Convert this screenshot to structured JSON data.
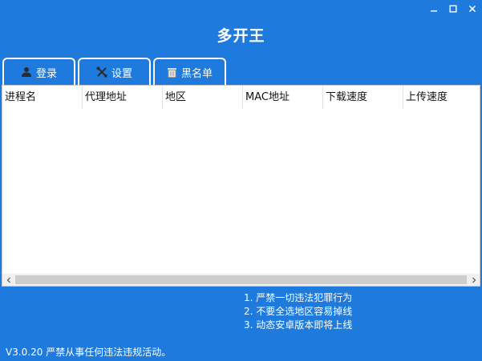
{
  "app": {
    "title": "多开王"
  },
  "tabs": [
    {
      "label": "登录",
      "icon": "user-icon"
    },
    {
      "label": "设置",
      "icon": "tools-icon"
    },
    {
      "label": "黑名单",
      "icon": "trash-icon"
    }
  ],
  "table": {
    "columns": [
      "进程名",
      "代理地址",
      "地区",
      "MAC地址",
      "下载速度",
      "上传速度"
    ],
    "rows": []
  },
  "notices": [
    "1. 严禁一切违法犯罪行为",
    "2. 不要全选地区容易掉线",
    "3. 动态安卓版本即将上线"
  ],
  "footer": {
    "version_text": "V3.0.20 严禁从事任何违法违规活动。"
  },
  "colors": {
    "background": "#1e7bdd",
    "panel": "#ffffff",
    "text_light": "#ffffff"
  }
}
